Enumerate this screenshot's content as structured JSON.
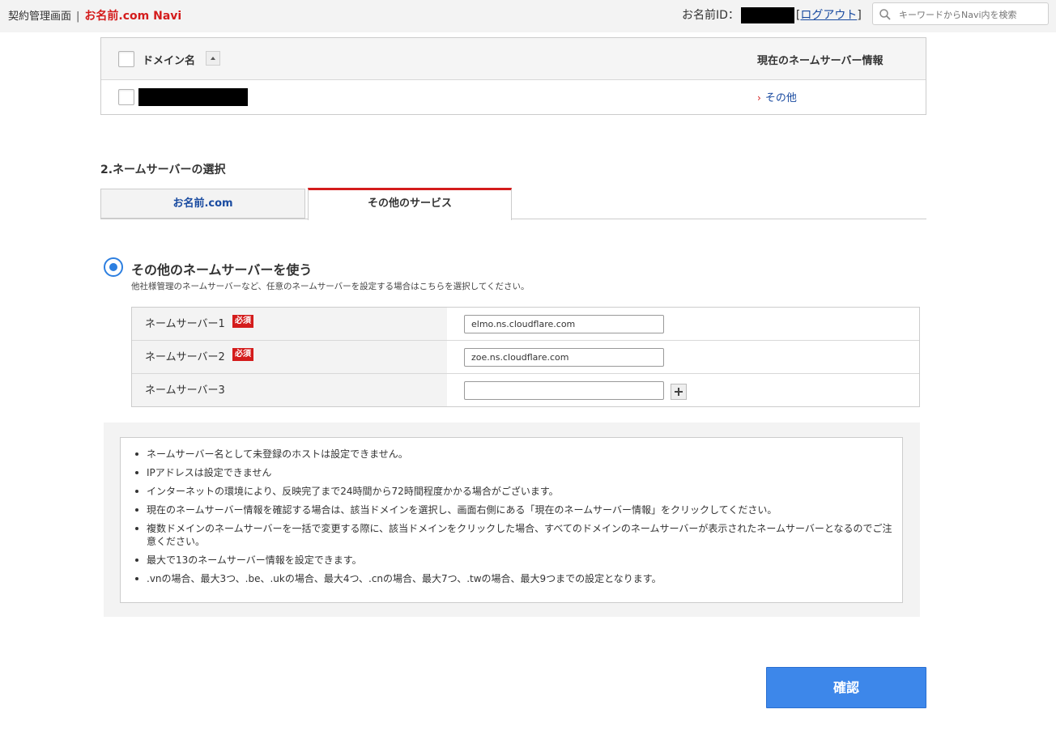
{
  "header": {
    "breadcrumb_label": "契約管理画面",
    "separator": "|",
    "brand": "お名前.com Navi",
    "id_label": "お名前ID：",
    "logout_open": "[",
    "logout_label": "ログアウト",
    "logout_close": "]",
    "search_placeholder": "キーワードからNavi内を検索"
  },
  "domain_table": {
    "col_domain": "ドメイン名",
    "col_nameserver": "現在のネームサーバー情報",
    "rows": [
      {
        "domain": "",
        "nameserver_link": "その他"
      }
    ]
  },
  "section": {
    "title": "2.ネームサーバーの選択",
    "tabs": [
      {
        "label": "お名前.com",
        "active": false
      },
      {
        "label": "その他のサービス",
        "active": true
      }
    ]
  },
  "option": {
    "label": "その他のネームサーバーを使う",
    "description": "他社様管理のネームサーバーなど、任意のネームサーバーを設定する場合はこちらを選択してください。",
    "selected": true
  },
  "nameservers": [
    {
      "label": "ネームサーバー1",
      "required_badge": "必須",
      "value": "elmo.ns.cloudflare.com"
    },
    {
      "label": "ネームサーバー2",
      "required_badge": "必須",
      "value": "zoe.ns.cloudflare.com"
    },
    {
      "label": "ネームサーバー3",
      "required_badge": "",
      "value": ""
    }
  ],
  "notes": [
    "ネームサーバー名として未登録のホストは設定できません。",
    "IPアドレスは設定できません",
    "インターネットの環境により、反映完了まで24時間から72時間程度かかる場合がございます。",
    "現在のネームサーバー情報を確認する場合は、該当ドメインを選択し、画面右側にある「現在のネームサーバー情報」をクリックしてください。",
    "複数ドメインのネームサーバーを一括で変更する際に、該当ドメインをクリックした場合、すべてのドメインのネームサーバーが表示されたネームサーバーとなるのでご注意ください。",
    "最大で13のネームサーバー情報を設定できます。",
    ".vnの場合、最大3つ、.be、.ukの場合、最大4つ、.cnの場合、最大7つ、.twの場合、最大9つまでの設定となります。"
  ],
  "confirm_label": "確認",
  "colors": {
    "brand_red": "#d41c1c",
    "link_blue": "#1a4ba0",
    "primary_button": "#3d87ea",
    "radio_blue": "#2d7fe0"
  }
}
